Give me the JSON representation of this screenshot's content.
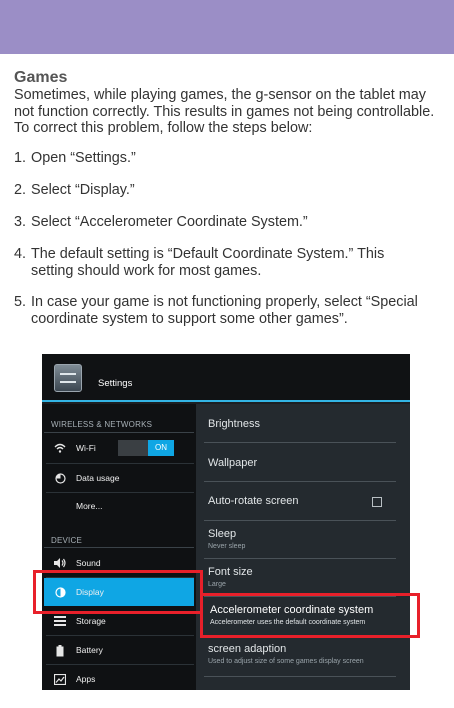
{
  "document": {
    "title": "Games",
    "intro": "Sometimes, while playing games, the g-sensor on the tablet may not function correctly. This results in games not being controllable. To correct this problem, follow the steps below:",
    "steps": [
      {
        "num": "1.",
        "text": "Open “Settings.”"
      },
      {
        "num": "2.",
        "text": "Select “Display.”"
      },
      {
        "num": "3.",
        "text": "Select “Accelerometer Coordinate System.”"
      },
      {
        "num": "4.",
        "text": "The default setting is “Default Coordinate System.” This setting should work for most games."
      },
      {
        "num": "5.",
        "text": "In case your game is not functioning properly, select “Special coordinate system to support some other games”."
      }
    ]
  },
  "screenshot": {
    "app_title": "Settings",
    "sidebar": {
      "wireless_header": "WIRELESS & NETWORKS",
      "device_header": "DEVICE",
      "items": [
        {
          "label": "Wi-Fi",
          "icon": "wifi-icon"
        },
        {
          "label": "Data usage",
          "icon": "data-usage-icon"
        },
        {
          "label": "More...",
          "icon": ""
        },
        {
          "label": "Sound",
          "icon": "sound-icon"
        },
        {
          "label": "Display",
          "icon": "display-icon",
          "selected": true
        },
        {
          "label": "Storage",
          "icon": "storage-icon"
        },
        {
          "label": "Battery",
          "icon": "battery-icon"
        },
        {
          "label": "Apps",
          "icon": "apps-icon"
        }
      ],
      "wifi_toggle": "ON"
    },
    "settings": [
      {
        "title": "Brightness",
        "summary": ""
      },
      {
        "title": "Wallpaper",
        "summary": ""
      },
      {
        "title": "Auto-rotate screen",
        "summary": ""
      },
      {
        "title": "Sleep",
        "summary": "Never sleep"
      },
      {
        "title": "Font size",
        "summary": "Large"
      },
      {
        "title": "Accelerometer coordinate system",
        "summary": "Accelerometer uses the default coordinate system"
      },
      {
        "title": "screen adaption",
        "summary": "Used to adjust size of some games display screen"
      }
    ],
    "colors": {
      "accent": "#0fa6e4",
      "highlight": "#e8202a",
      "band": "#9b8ec6"
    }
  }
}
